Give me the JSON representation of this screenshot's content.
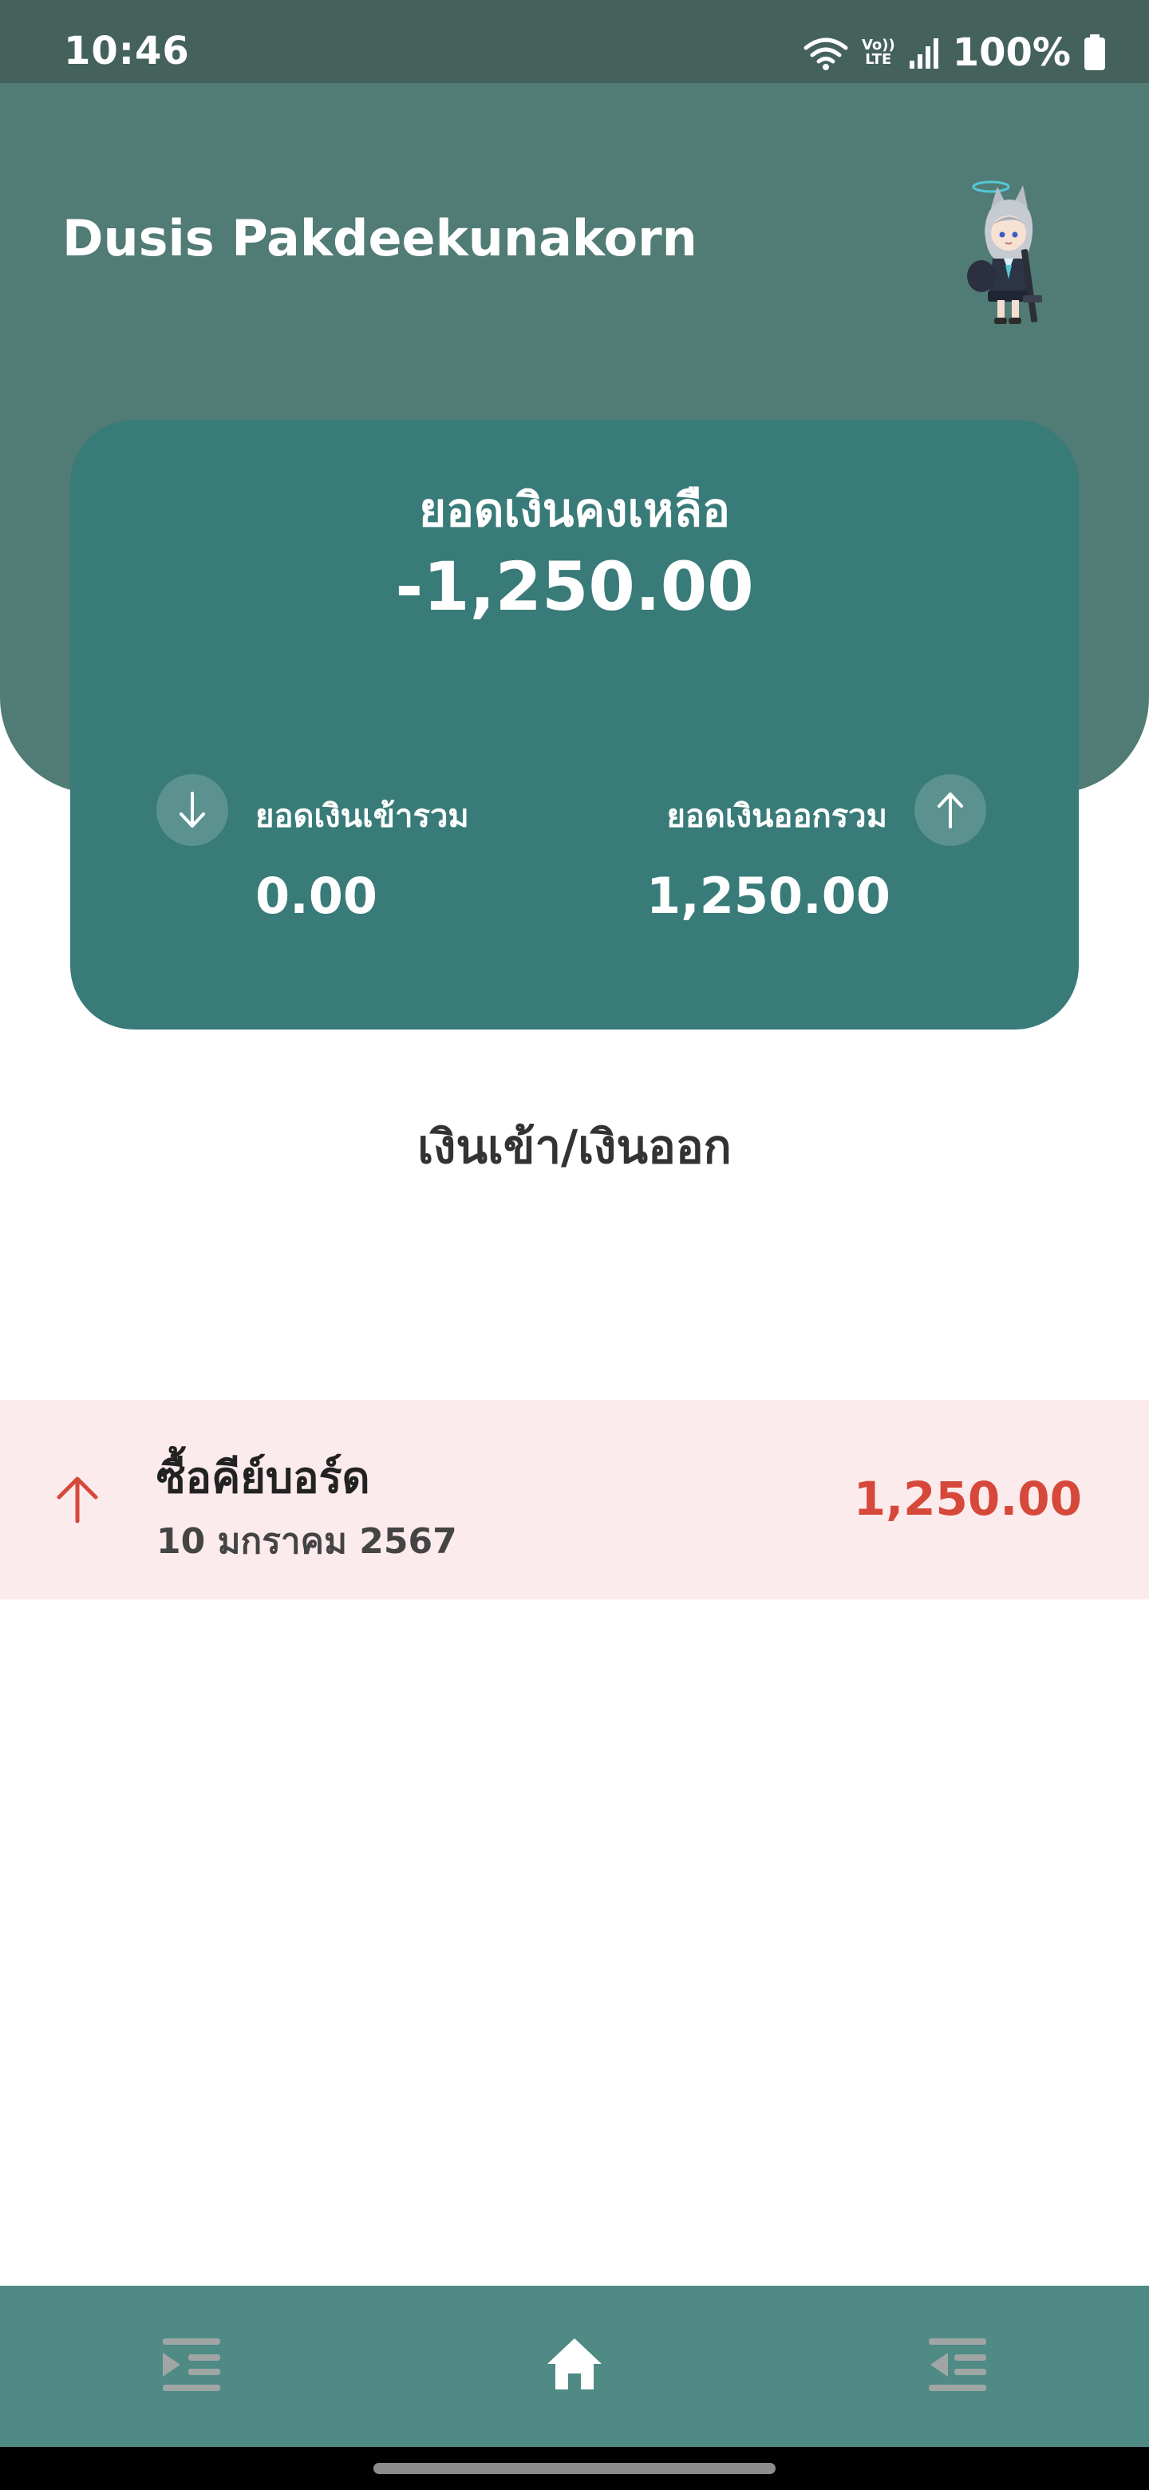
{
  "status_bar": {
    "time": "10:46",
    "volte_top": "Vo))",
    "volte_bottom": "LTE",
    "battery": "100%"
  },
  "header": {
    "user_name": "Dusis Pakdeekunakorn",
    "avatar_icon": "chibi-character-avatar"
  },
  "balance_card": {
    "label": "ยอดเงินคงเหลือ",
    "value": "-1,250.00",
    "income_label": "ยอดเงินเข้ารวม",
    "income_value": "0.00",
    "expense_label": "ยอดเงินออกรวม",
    "expense_value": "1,250.00"
  },
  "section": {
    "title": "เงินเข้า/เงินออก"
  },
  "transactions": [
    {
      "title": "ซื้อคีย์บอร์ด",
      "date": "10 มกราคม 2567",
      "amount": "1,250.00",
      "direction": "out",
      "icon": "arrow-up-icon"
    }
  ],
  "bottom_nav": {
    "items": [
      {
        "icon": "indent-menu-icon"
      },
      {
        "icon": "home-icon",
        "active": true
      },
      {
        "icon": "outdent-menu-icon"
      }
    ]
  },
  "colors": {
    "status_bar": "#44615c",
    "header": "#517b75",
    "card": "#387b78",
    "nav": "#4f8a84",
    "expense_red": "#d6483a",
    "expense_row_bg": "#fcebed"
  }
}
